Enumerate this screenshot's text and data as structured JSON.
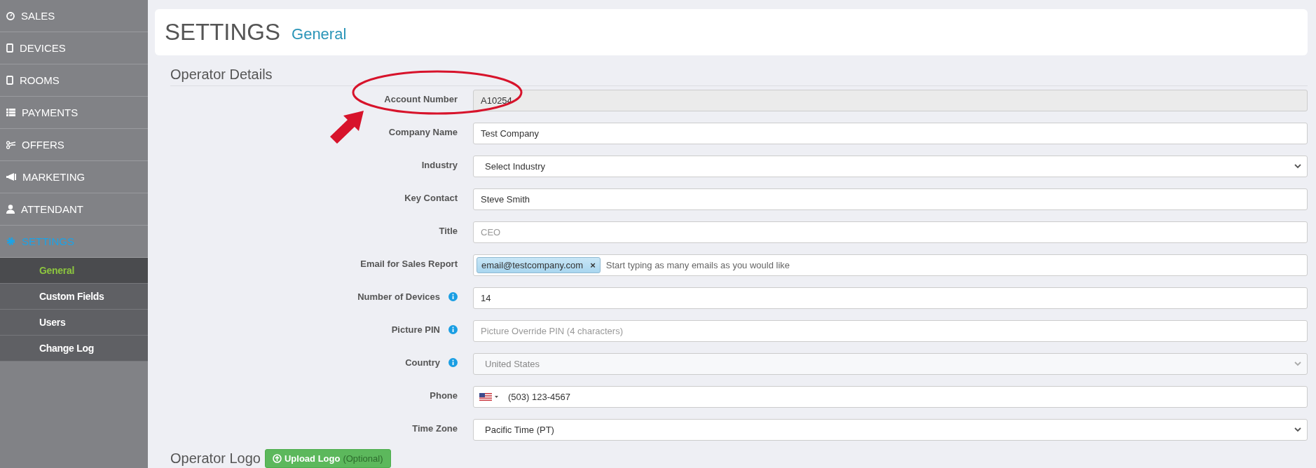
{
  "sidebar": {
    "items": [
      {
        "label": "SALES",
        "selected": false
      },
      {
        "label": "DEVICES",
        "selected": false
      },
      {
        "label": "ROOMS",
        "selected": false
      },
      {
        "label": "PAYMENTS",
        "selected": false
      },
      {
        "label": "OFFERS",
        "selected": false
      },
      {
        "label": "MARKETING",
        "selected": false
      },
      {
        "label": "ATTENDANT",
        "selected": false
      },
      {
        "label": "SETTINGS",
        "selected": true,
        "children": [
          {
            "label": "General",
            "selected": true
          },
          {
            "label": "Custom Fields",
            "selected": false
          },
          {
            "label": "Users",
            "selected": false
          },
          {
            "label": "Change Log",
            "selected": false
          }
        ]
      }
    ]
  },
  "header": {
    "title": "SETTINGS",
    "subtitle": "General"
  },
  "section": {
    "title": "Operator Details"
  },
  "fields": [
    {
      "label": "Account Number",
      "kind": "text",
      "value": "A10254",
      "disabled": true
    },
    {
      "label": "Company Name",
      "kind": "text",
      "value": "Test Company"
    },
    {
      "label": "Industry",
      "kind": "select",
      "value": "Select Industry"
    },
    {
      "label": "Key Contact",
      "kind": "text",
      "value": "Steve Smith"
    },
    {
      "label": "Title",
      "kind": "text",
      "placeholder": "CEO"
    },
    {
      "label": "Email for Sales Report",
      "kind": "tags",
      "tags": [
        "email@testcompany.com"
      ],
      "tag_remove": "×",
      "placeholder": "Start typing as many emails as you would like"
    },
    {
      "label": "Number of Devices",
      "kind": "text",
      "value": "14",
      "info": true
    },
    {
      "label": "Picture PIN",
      "kind": "text",
      "placeholder": "Picture Override PIN (4 characters)",
      "info": true
    },
    {
      "label": "Country",
      "kind": "select",
      "value": "United States",
      "disabled": true,
      "info": true
    },
    {
      "label": "Phone",
      "kind": "phone",
      "value": "(503) 123-4567"
    },
    {
      "label": "Time Zone",
      "kind": "select",
      "value": "Pacific Time (PT)"
    }
  ],
  "logo": {
    "title": "Operator Logo",
    "button": "Upload Logo",
    "button_note": "(Optional)"
  }
}
